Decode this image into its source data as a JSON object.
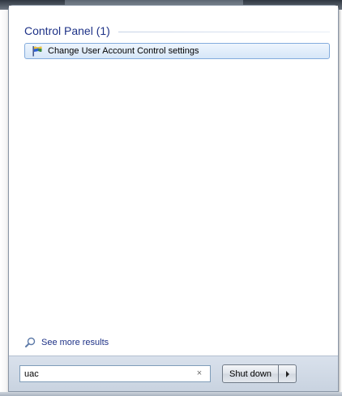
{
  "results": {
    "group_title": "Control Panel (1)",
    "items": [
      {
        "label": "Change User Account Control settings",
        "icon": "uac-flag-icon"
      }
    ],
    "see_more": "See more results"
  },
  "search": {
    "value": "uac",
    "clear_label": "×"
  },
  "power": {
    "shutdown_label": "Shut down",
    "arrow_icon": "arrow-right-icon"
  },
  "colors": {
    "group_title": "#1e3287",
    "item_highlight": "#d6e6f8",
    "item_border": "#84acdd",
    "bottom_bar": "#d9e1ec"
  }
}
